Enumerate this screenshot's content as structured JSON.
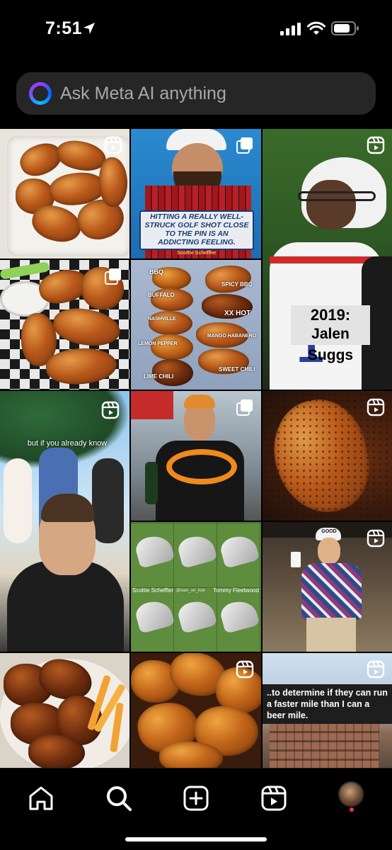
{
  "status": {
    "time": "7:51"
  },
  "search": {
    "placeholder": "Ask Meta AI anything"
  },
  "grid": {
    "golf_quote": {
      "quote": "HITTING A REALLY WELL-STRUCK GOLF SHOT CLOSE TO THE PIN IS AN ADDICTING FEELING.",
      "attribution": "Scottie Scheffler"
    },
    "wing_flavors": [
      "BBQ",
      "SPICY BBQ",
      "BUFFALO",
      "NASHVILLE",
      "XX HOT",
      "LEMON PEPPER",
      "MANGO HABANERO",
      "LIME CHILI",
      "SWEET CHILI"
    ],
    "suggs": {
      "line1": "2019:",
      "line2": "Jalen Suggs"
    },
    "reel_caption": "but if you already know",
    "wedges": {
      "left_name": "Scottie Scheffler",
      "right_name": "Tommy Fleetwood",
      "mid_tag": "@sam_on_tour"
    },
    "good_hat": "GOOD",
    "beer_mile": "..to determine if they can run a faster mile than I can a beer mile."
  },
  "nav": {
    "items": [
      "home",
      "search",
      "create",
      "reels",
      "profile"
    ]
  }
}
